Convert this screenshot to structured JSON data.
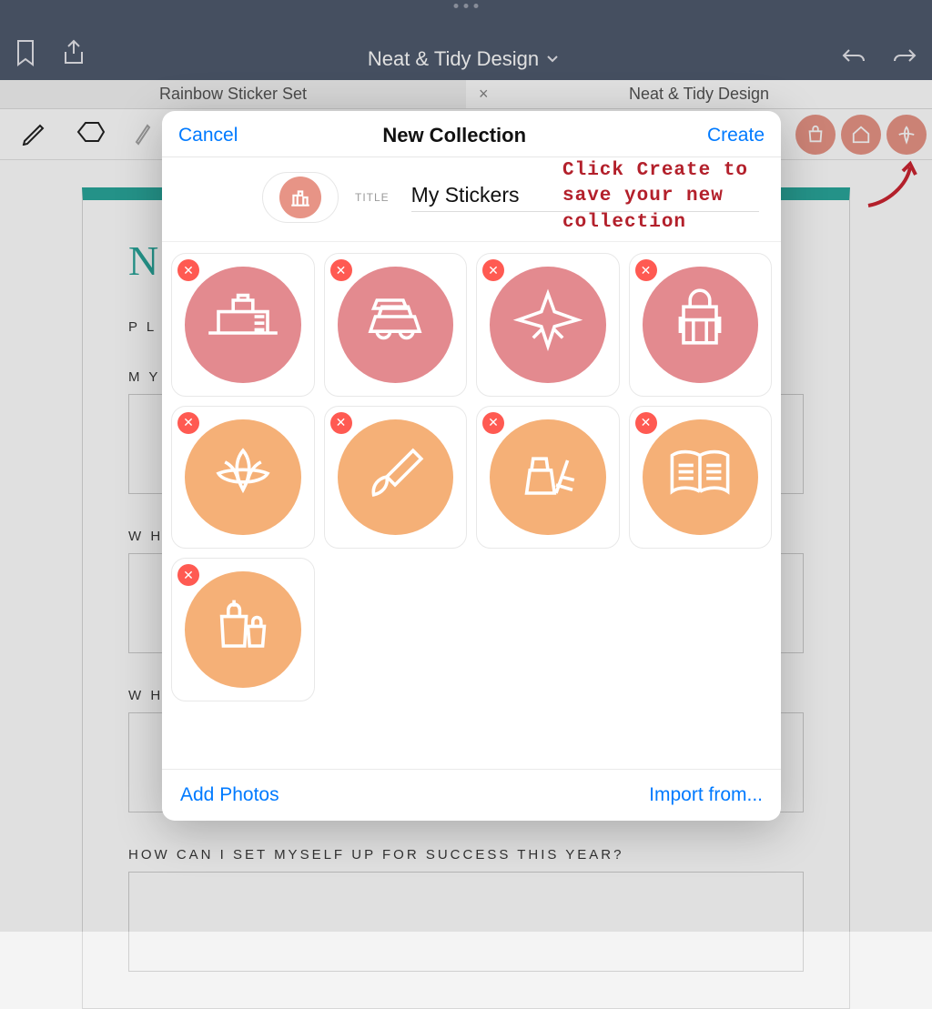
{
  "topbar": {
    "title": "Neat & Tidy Design"
  },
  "tabs": [
    {
      "label": "Rainbow Sticker Set",
      "active": false
    },
    {
      "label": "Neat & Tidy Design",
      "active": true
    }
  ],
  "page": {
    "title_initial": "N",
    "section_pl": "P L",
    "section_my": "M Y",
    "section_wh1": "W H",
    "section_wh2": "W H",
    "section_success": "How can I set myself up for success this year?"
  },
  "modal": {
    "cancel_label": "Cancel",
    "header_title": "New Collection",
    "create_label": "Create",
    "title_label": "TITLE",
    "title_value": "My Stickers",
    "add_photos_label": "Add Photos",
    "import_label": "Import from...",
    "stickers": [
      {
        "name": "desk-icon",
        "color": "pink"
      },
      {
        "name": "car-icon",
        "color": "pink"
      },
      {
        "name": "airplane-icon",
        "color": "pink"
      },
      {
        "name": "backpack-icon",
        "color": "pink"
      },
      {
        "name": "lotus-icon",
        "color": "orange"
      },
      {
        "name": "paintbrush-icon",
        "color": "orange"
      },
      {
        "name": "cleaning-icon",
        "color": "orange"
      },
      {
        "name": "book-icon",
        "color": "orange"
      },
      {
        "name": "shopping-icon",
        "color": "orange"
      }
    ]
  },
  "annotation": {
    "text": "Click Create to save your new collection"
  }
}
